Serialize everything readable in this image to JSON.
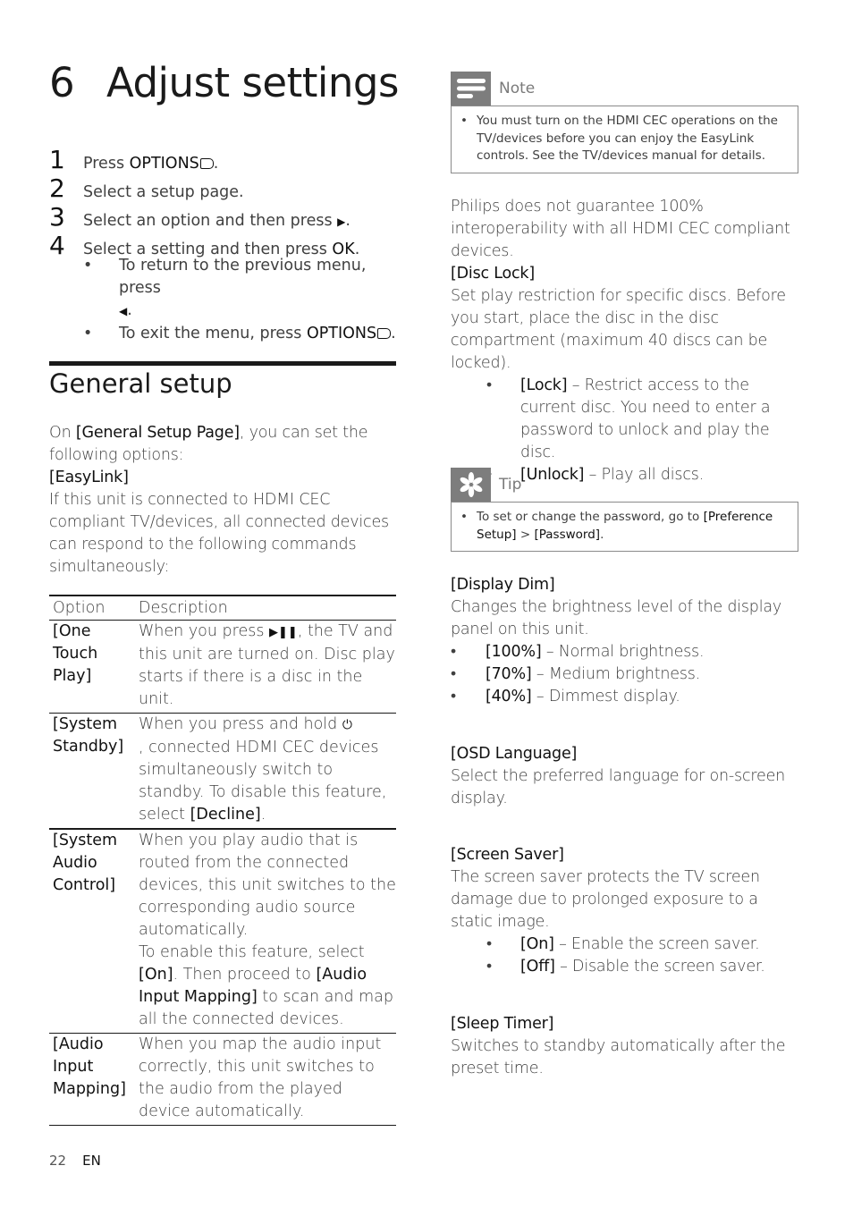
{
  "chapter": {
    "number": "6",
    "title": "Adjust settings"
  },
  "steps": [
    {
      "n": "1",
      "pre": "Press ",
      "bold": "OPTIONS",
      "icon": "options-icon",
      "post": "."
    },
    {
      "n": "2",
      "pre": "Select a setup page.",
      "bold": "",
      "post": ""
    },
    {
      "n": "3",
      "pre": "Select an option and then press ",
      "bold": "",
      "icon": "play-right-icon",
      "post": "."
    },
    {
      "n": "4",
      "pre": "Select a setting and then press ",
      "bold": "OK",
      "post": "."
    }
  ],
  "step_subitems": [
    {
      "bullet": "•",
      "text": "To return to the previous menu, press",
      "icon": "left-arrow-icon",
      "post": "."
    },
    {
      "bullet": "•",
      "pre": "To exit the menu, press ",
      "bold": "OPTIONS",
      "post": "."
    }
  ],
  "section": {
    "title": "General setup",
    "intro_pre": "On ",
    "intro_bold": "[General Setup Page]",
    "intro_post": ", you can set the following options:",
    "easylink_label": "[EasyLink]",
    "easylink_desc": "If this unit is connected to HDMI CEC compliant TV/devices, all connected devices can respond to the following commands simultaneously:"
  },
  "table": {
    "headers": [
      "Option",
      "Description"
    ],
    "rows": [
      {
        "option": "[One Touch Play]",
        "desc_pre": "When you press ",
        "desc_icon": "play-pause-icon",
        "desc_post": ", the TV and this unit are turned on. Disc play starts if there is a disc in the unit."
      },
      {
        "option": "[System Standby]",
        "desc_pre": "When you press and hold ",
        "desc_icon": "power-icon",
        "desc_post": ", connected HDMI CEC devices simultaneously switch to standby. To disable this feature, select ",
        "desc_bold": "[Decline]",
        "desc_end": "."
      },
      {
        "option": "[System Audio Control]",
        "desc_a": "When you play audio that is routed from the connected devices, this unit switches to the corresponding audio source automatically.",
        "desc_b_pre": "To enable this feature, select ",
        "desc_b_bold": "[On]",
        "desc_b_mid": ". Then proceed to ",
        "desc_b_bold2": "[Audio Input Mapping]",
        "desc_b_post": " to scan and map all the connected devices."
      },
      {
        "option": "[Audio Input Mapping]",
        "desc": "When you map the audio input correctly, this unit switches to the audio from the played device automatically."
      }
    ]
  },
  "note": {
    "label": "Note",
    "icon": "note-icon",
    "text": "You must turn on the HDMI CEC operations on the TV/devices before you can enjoy the EasyLink controls. See the TV/devices manual for details."
  },
  "philips_disclaimer": "Philips does not guarantee 100% interoperability with all HDMI CEC compliant devices.",
  "disc_lock": {
    "label": "[Disc Lock]",
    "desc": "Set play restriction for specific discs. Before you start, place the disc in the disc compartment (maximum 40 discs can be locked).",
    "items": [
      {
        "bold": "[Lock]",
        "text": " – Restrict access to the current disc. You need to enter a password to unlock and play the disc."
      },
      {
        "bold": "[Unlock]",
        "text": " – Play all discs."
      }
    ]
  },
  "tip": {
    "label": "Tip",
    "icon": "tip-asterisk-icon",
    "pre": "To set or change the password, go to ",
    "bold1": "[Preference Setup]",
    "sep": " > ",
    "bold2": "[Password]",
    "post": "."
  },
  "display_dim": {
    "label": "[Display Dim]",
    "desc": "Changes the brightness level of the display panel on this unit.",
    "items": [
      {
        "bold": "[100%]",
        "text": " – Normal brightness."
      },
      {
        "bold": "[70%]",
        "text": " – Medium brightness."
      },
      {
        "bold": "[40%]",
        "text": " – Dimmest display."
      }
    ]
  },
  "osd_language": {
    "label": "[OSD Language]",
    "desc": "Select the preferred language for on-screen display."
  },
  "screen_saver": {
    "label": "[Screen Saver]",
    "desc": "The screen saver protects the TV screen damage due to prolonged exposure to a static image.",
    "items": [
      {
        "bold": "[On]",
        "text": " – Enable the screen saver."
      },
      {
        "bold": "[Off]",
        "text": " – Disable the screen saver."
      }
    ]
  },
  "sleep_timer": {
    "label": "[Sleep Timer]",
    "desc": "Switches to standby automatically after the preset time."
  },
  "footer": {
    "page": "22",
    "lang": "EN"
  }
}
